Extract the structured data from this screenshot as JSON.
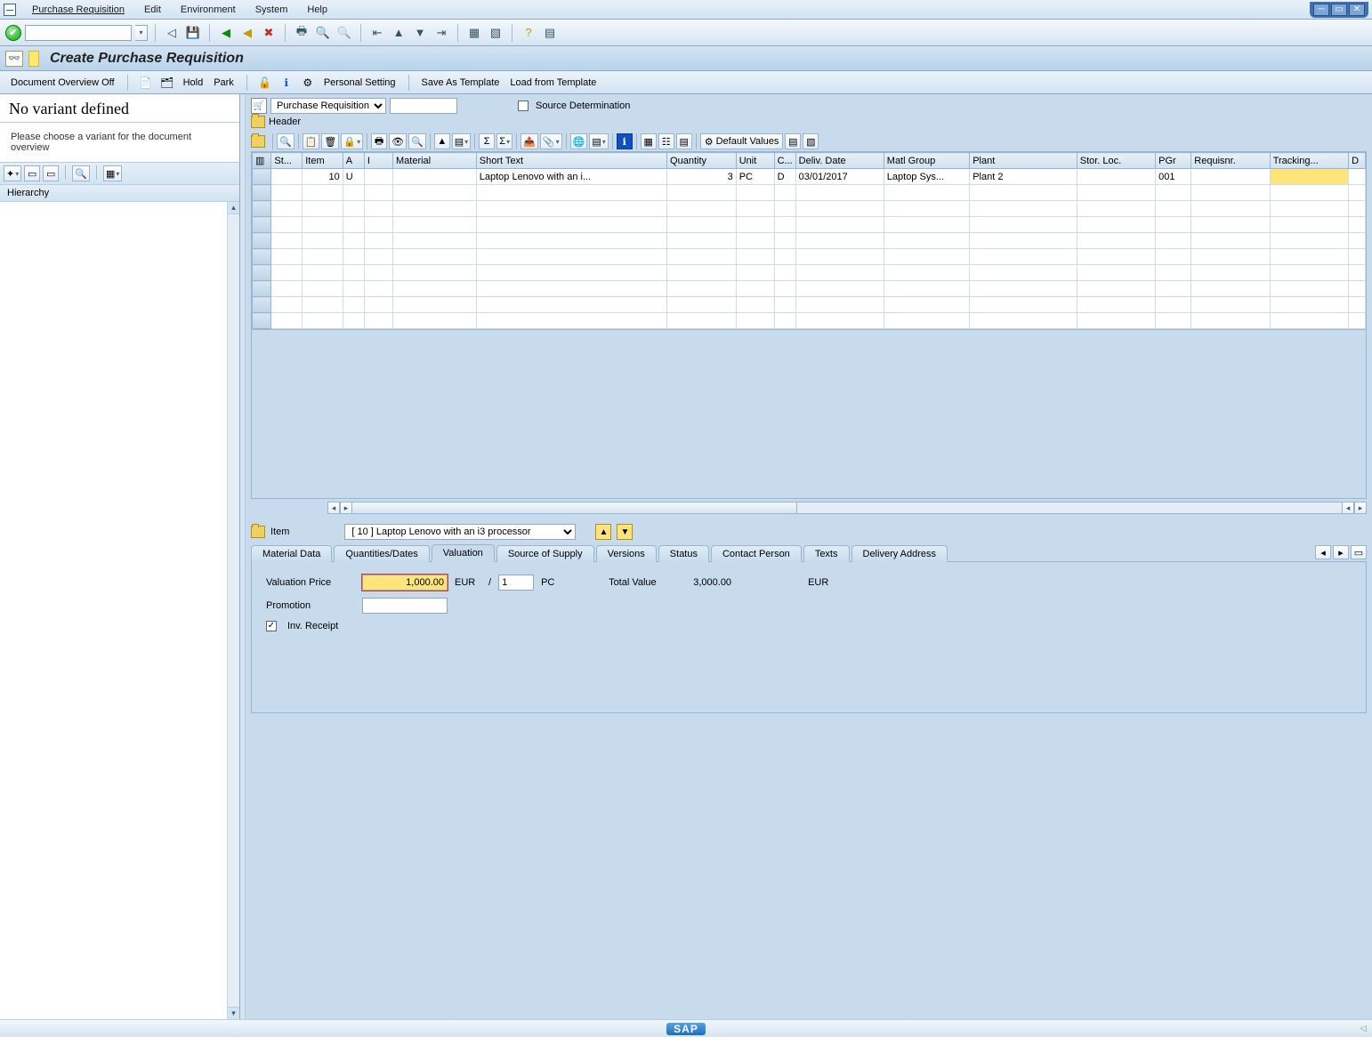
{
  "menu": {
    "items": [
      "Purchase Requisition",
      "Edit",
      "Environment",
      "System",
      "Help"
    ]
  },
  "page_title": "Create Purchase Requisition",
  "app_toolbar": {
    "doc_overview": "Document Overview Off",
    "hold": "Hold",
    "park": "Park",
    "personal_setting": "Personal Setting",
    "save_template": "Save As Template",
    "load_template": "Load from Template"
  },
  "left": {
    "title": "No variant defined",
    "subtitle": "Please choose a variant for the document overview",
    "hierarchy_label": "Hierarchy"
  },
  "pr": {
    "type_label": "Purchase Requisition",
    "number": "",
    "source_det": "Source Determination",
    "header_label": "Header",
    "default_values": "Default Values"
  },
  "grid": {
    "headers": [
      "St...",
      "Item",
      "A",
      "I",
      "Material",
      "Short Text",
      "Quantity",
      "Unit",
      "C...",
      "Deliv. Date",
      "Matl Group",
      "Plant",
      "Stor. Loc.",
      "PGr",
      "Requisnr.",
      "Tracking...",
      "D"
    ],
    "rows": [
      {
        "st": "",
        "item": "10",
        "a": "U",
        "i": "",
        "material": "",
        "short_text": "Laptop Lenovo with an i...",
        "quantity": "3",
        "unit": "PC",
        "c": "D",
        "deliv_date": "03/01/2017",
        "matl_group": "Laptop Sys...",
        "plant": "Plant 2",
        "stor_loc": "",
        "pgr": "001",
        "requisnr": "",
        "tracking": ""
      }
    ]
  },
  "item": {
    "label": "Item",
    "selected_display": "[ 10 ] Laptop Lenovo with an i3 processor",
    "tabs": [
      "Material Data",
      "Quantities/Dates",
      "Valuation",
      "Source of Supply",
      "Versions",
      "Status",
      "Contact Person",
      "Texts",
      "Delivery Address"
    ],
    "active_tab_index": 2,
    "valuation": {
      "price_label": "Valuation Price",
      "price_value": "1,000.00",
      "currency": "EUR",
      "slash": "/",
      "per_qty": "1",
      "per_unit": "PC",
      "total_label": "Total Value",
      "total_value": "3,000.00",
      "total_currency": "EUR",
      "promotion_label": "Promotion",
      "promotion_value": "",
      "inv_receipt_label": "Inv. Receipt",
      "inv_receipt_checked": true
    }
  },
  "footer_brand": "SAP"
}
